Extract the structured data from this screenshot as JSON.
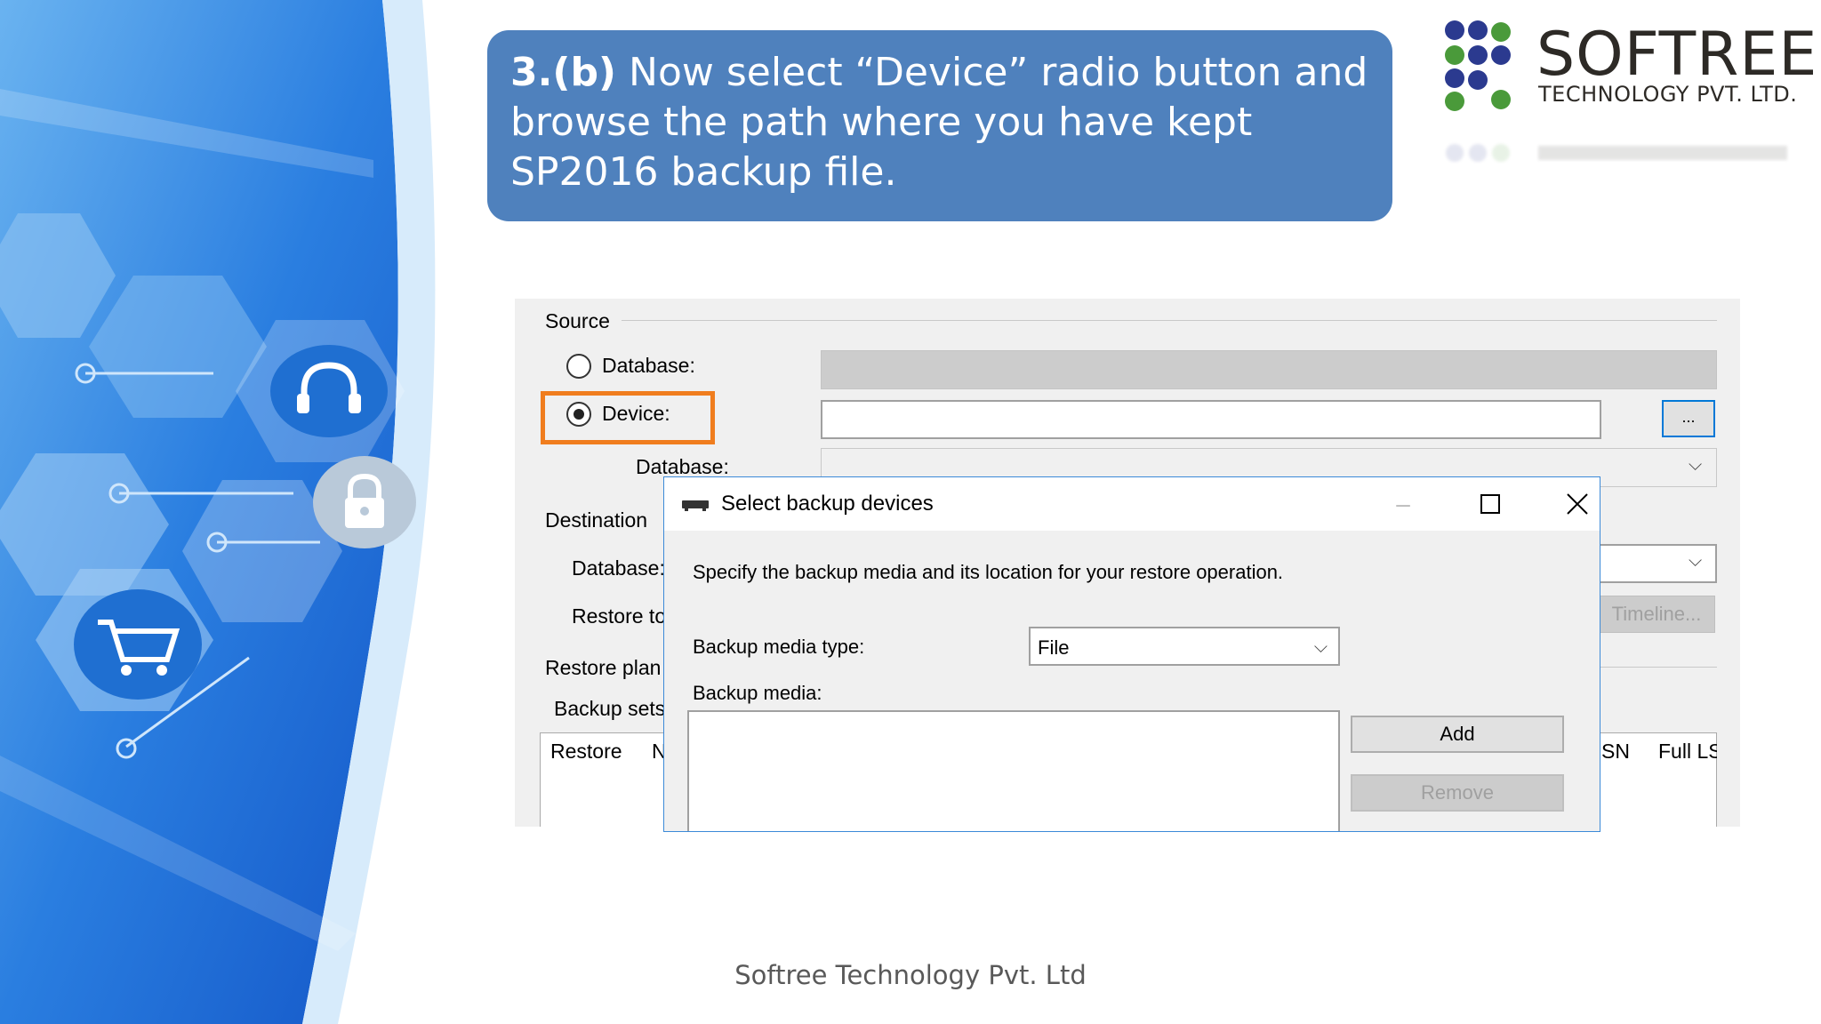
{
  "title": {
    "step": "3.(b)",
    "text": " Now select “Device” radio button and browse the path where you have kept SP2016 backup file."
  },
  "logo": {
    "name": "SOFTREE",
    "subtitle": "TECHNOLOGY PVT. LTD."
  },
  "restore": {
    "source_label": "Source",
    "database_radio_label": "Database:",
    "device_radio_label": "Device:",
    "browse_button_label": "...",
    "source_database_label": "Database:",
    "destination_label": "Destination",
    "dest_database_label": "Database:",
    "restore_to_label": "Restore to",
    "timeline_button_label": "Timeline...",
    "restore_plan_label": "Restore plan",
    "backup_sets_label": "Backup sets",
    "columns": [
      "Restore",
      "N",
      "SN",
      "Full LS"
    ]
  },
  "dialog": {
    "title": "Select backup devices",
    "description": "Specify the backup media and its location for your restore operation.",
    "media_type_label": "Backup media type:",
    "media_type_value": "File",
    "media_label": "Backup media:",
    "add_button": "Add",
    "remove_button": "Remove"
  },
  "footer": "Softree Technology Pvt. Ltd",
  "colors": {
    "title_box": "#4f81bd",
    "highlight": "#f07d1e",
    "logo_blue": "#2b3a8f",
    "logo_green": "#4a9a3a"
  }
}
